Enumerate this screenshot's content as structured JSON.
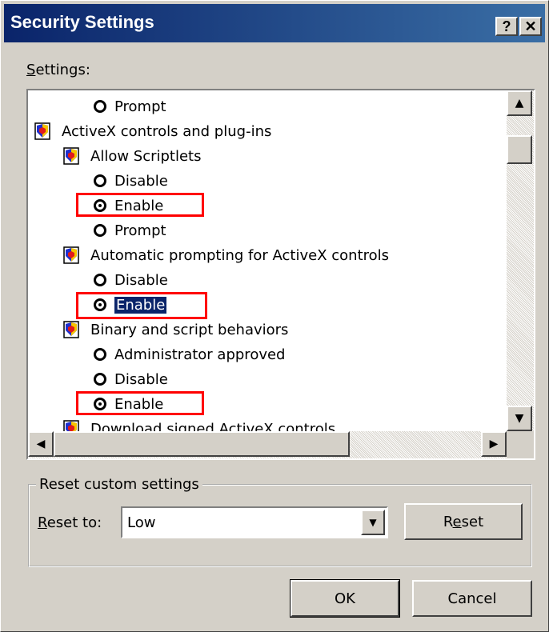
{
  "window": {
    "title": "Security Settings",
    "help_label": "?",
    "close_label": "✕"
  },
  "settings_label": "Settings:",
  "tree": [
    {
      "kind": "radio",
      "label": "Prompt",
      "checked": false
    },
    {
      "kind": "category",
      "label": "ActiveX controls and plug-ins",
      "icon": "settings-category-icon"
    },
    {
      "kind": "setting",
      "label": "Allow Scriptlets",
      "icon": "setting-icon"
    },
    {
      "kind": "radio",
      "label": "Disable",
      "checked": false
    },
    {
      "kind": "radio",
      "label": "Enable",
      "checked": true,
      "highlight": true
    },
    {
      "kind": "radio",
      "label": "Prompt",
      "checked": false
    },
    {
      "kind": "setting",
      "label": "Automatic prompting for ActiveX controls",
      "icon": "setting-icon"
    },
    {
      "kind": "radio",
      "label": "Disable",
      "checked": false
    },
    {
      "kind": "radio",
      "label": "Enable",
      "checked": true,
      "highlight": true,
      "selected": true
    },
    {
      "kind": "setting",
      "label": "Binary and script behaviors",
      "icon": "setting-icon"
    },
    {
      "kind": "radio",
      "label": "Administrator approved",
      "checked": false
    },
    {
      "kind": "radio",
      "label": "Disable",
      "checked": false
    },
    {
      "kind": "radio",
      "label": "Enable",
      "checked": true,
      "highlight": true
    },
    {
      "kind": "setting",
      "label": "Download signed ActiveX controls",
      "icon": "setting-icon"
    }
  ],
  "reset": {
    "legend": "Reset custom settings",
    "reset_to_label": "Reset to:",
    "reset_to_value": "Low",
    "reset_button": "Reset"
  },
  "buttons": {
    "ok": "OK",
    "cancel": "Cancel"
  },
  "colors": {
    "highlight_box": "#ff0000",
    "selection": "#0a246a",
    "titlebar": "#0a246a"
  }
}
